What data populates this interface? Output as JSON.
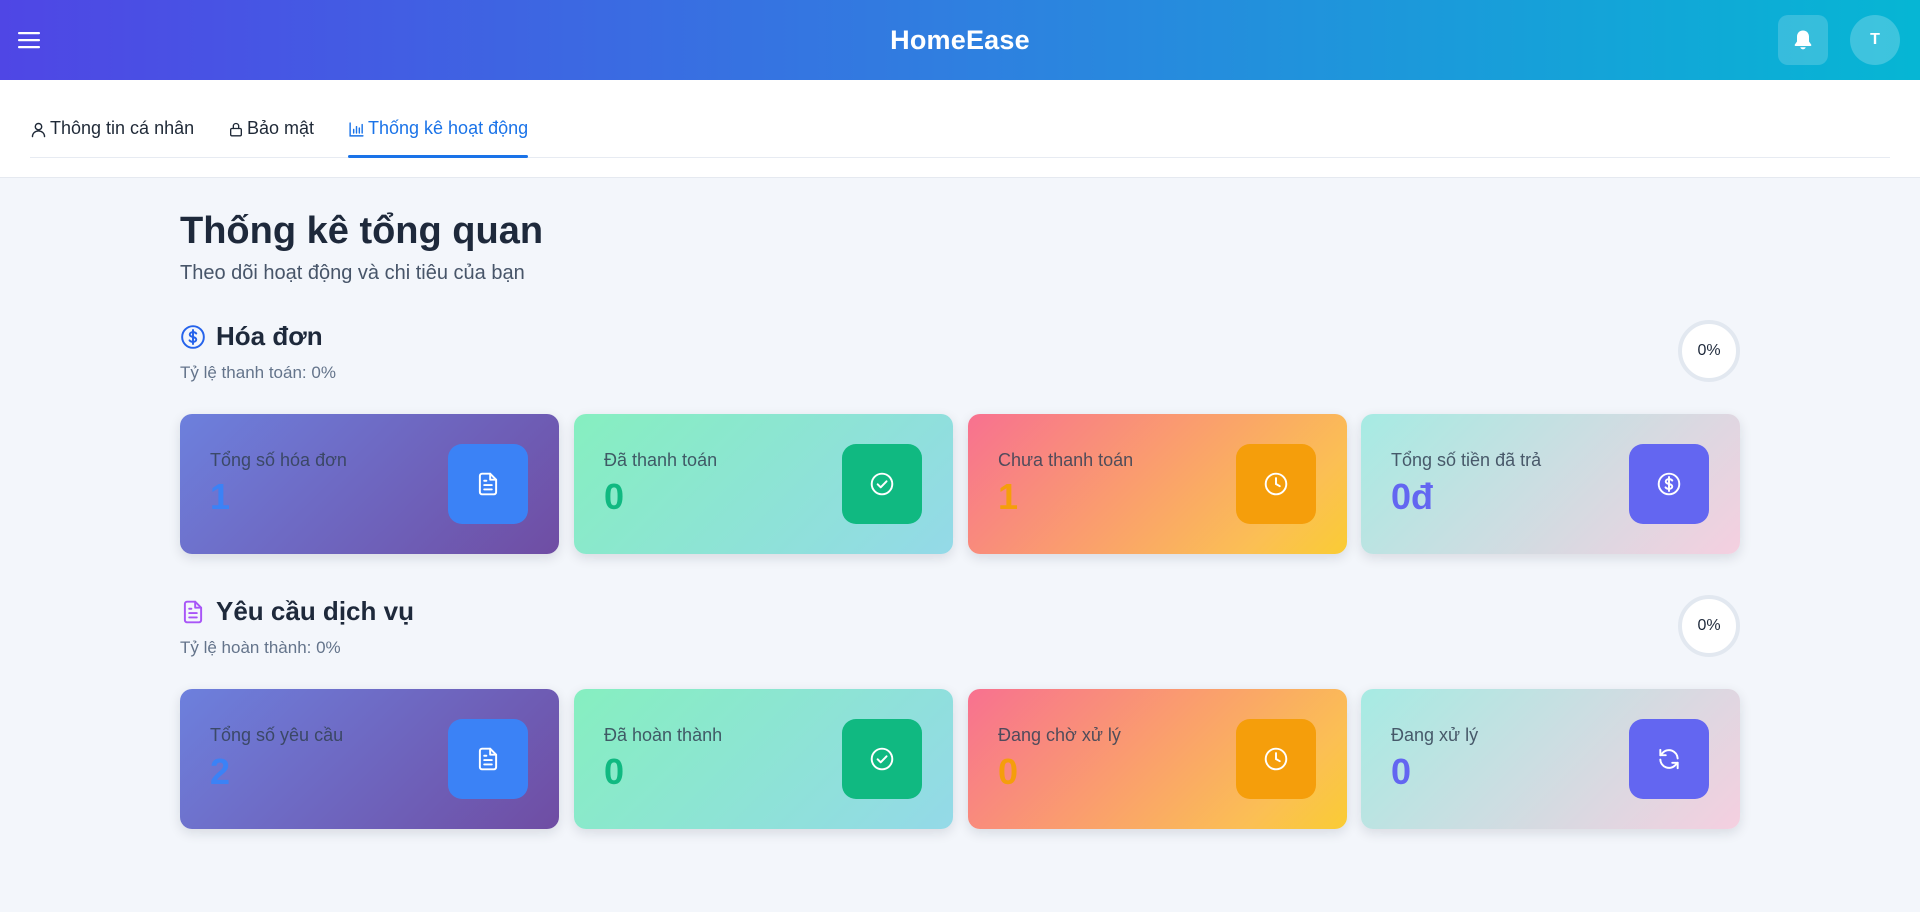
{
  "app": {
    "brand": "HomeEase",
    "avatar_initial": "T"
  },
  "tabs": [
    {
      "label": "Thông tin cá nhân",
      "icon": "user-icon",
      "active": false
    },
    {
      "label": "Bảo mật",
      "icon": "lock-icon",
      "active": false
    },
    {
      "label": "Thống kê hoạt động",
      "icon": "bar-chart-icon",
      "active": true
    }
  ],
  "page": {
    "title": "Thống kê tổng quan",
    "subtitle": "Theo dõi hoạt động và chi tiêu của bạn"
  },
  "invoices": {
    "title": "Hóa đơn",
    "icon": "dollar-circle-icon",
    "rate_text": "Tỷ lệ thanh toán: 0%",
    "progress": "0%",
    "cards": [
      {
        "label": "Tổng số hóa đơn",
        "value": "1",
        "icon": "document-icon",
        "value_color": "#3b82f6",
        "icon_bg": "#3b82f6"
      },
      {
        "label": "Đã thanh toán",
        "value": "0",
        "icon": "check-circle-icon",
        "value_color": "#10b981",
        "icon_bg": "#10b981"
      },
      {
        "label": "Chưa thanh toán",
        "value": "1",
        "icon": "clock-icon",
        "value_color": "#f59e0b",
        "icon_bg": "#f59e0b"
      },
      {
        "label": "Tổng số tiền đã trả",
        "value": "0đ",
        "icon": "dollar-circle-icon",
        "value_color": "#6366f1",
        "icon_bg": "#6366f1"
      }
    ]
  },
  "services": {
    "title": "Yêu cầu dịch vụ",
    "icon": "document-icon",
    "rate_text": "Tỷ lệ hoàn thành: 0%",
    "progress": "0%",
    "cards": [
      {
        "label": "Tổng số yêu cầu",
        "value": "2",
        "icon": "document-icon",
        "value_color": "#3b82f6",
        "icon_bg": "#3b82f6"
      },
      {
        "label": "Đã hoàn thành",
        "value": "0",
        "icon": "check-circle-icon",
        "value_color": "#10b981",
        "icon_bg": "#10b981"
      },
      {
        "label": "Đang chờ xử lý",
        "value": "0",
        "icon": "clock-icon",
        "value_color": "#f59e0b",
        "icon_bg": "#f59e0b"
      },
      {
        "label": "Đang xử lý",
        "value": "0",
        "icon": "refresh-icon",
        "value_color": "#6366f1",
        "icon_bg": "#6366f1"
      }
    ]
  }
}
